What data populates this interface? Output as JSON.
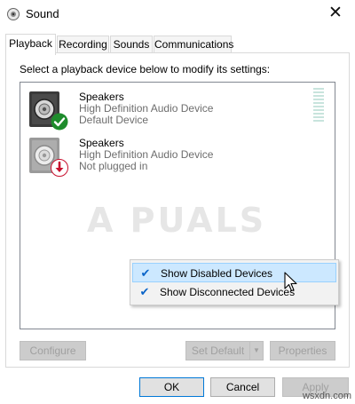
{
  "window": {
    "title": "Sound",
    "close_glyph": "✕"
  },
  "tabs": [
    {
      "label": "Playback",
      "active": true
    },
    {
      "label": "Recording",
      "active": false
    },
    {
      "label": "Sounds",
      "active": false
    },
    {
      "label": "Communications",
      "active": false
    }
  ],
  "instruction": "Select a playback device below to modify its settings:",
  "devices": [
    {
      "name": "Speakers",
      "driver": "High Definition Audio Device",
      "status": "Default Device",
      "status_icon": "green-check-icon",
      "status_color": "#1e8c2c"
    },
    {
      "name": "Speakers",
      "driver": "High Definition Audio Device",
      "status": "Not plugged in",
      "status_icon": "red-down-arrow-icon",
      "status_color": "#c8102e"
    }
  ],
  "watermark": "A PUALS",
  "context_menu": {
    "items": [
      {
        "label": "Show Disabled Devices",
        "checked": true,
        "highlighted": true
      },
      {
        "label": "Show Disconnected Devices",
        "checked": true,
        "highlighted": false
      }
    ],
    "check_glyph": "✔"
  },
  "buttons": {
    "configure": "Configure",
    "set_default": "Set Default",
    "set_default_arrow": "▼",
    "properties": "Properties",
    "ok": "OK",
    "cancel": "Cancel",
    "apply": "Apply"
  },
  "brand_watermark": "wsxdn.com",
  "colors": {
    "accent": "#0078d7",
    "menu_highlight": "#cce8ff",
    "default_badge": "#1e8c2c",
    "unplugged_badge": "#c8102e"
  }
}
